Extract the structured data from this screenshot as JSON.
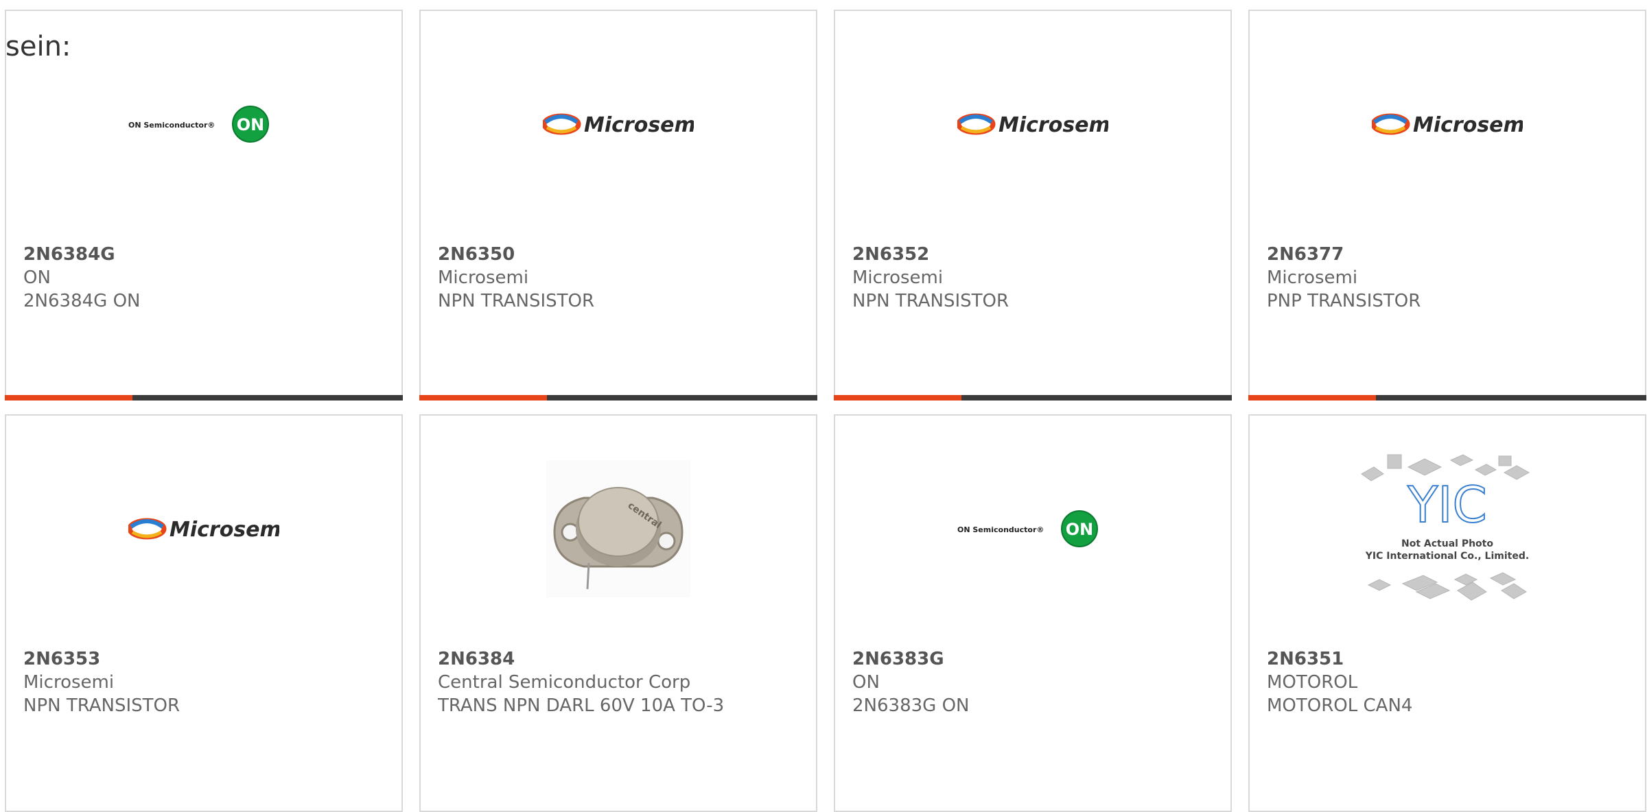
{
  "page": {
    "title": "sein:"
  },
  "colors": {
    "progress_fill": "#e8441a",
    "progress_track": "#3b3b3b",
    "on_green": "#13a040",
    "border": "#d9d9d9"
  },
  "cards": [
    {
      "part_number": "2N6384G",
      "manufacturer": "ON",
      "description": "2N6384G ON",
      "logo": "on-semiconductor-logo",
      "logo_text": "ON Semiconductor®",
      "badge_text": "ON",
      "progress_fraction": 0.32
    },
    {
      "part_number": "2N6350",
      "manufacturer": "Microsemi",
      "description": "NPN TRANSISTOR",
      "logo": "microsemi-logo",
      "logo_text": "Microsemi",
      "progress_fraction": 0.32
    },
    {
      "part_number": "2N6352",
      "manufacturer": "Microsemi",
      "description": "NPN TRANSISTOR",
      "logo": "microsemi-logo",
      "logo_text": "Microsemi",
      "progress_fraction": 0.32
    },
    {
      "part_number": "2N6377",
      "manufacturer": "Microsemi",
      "description": "PNP TRANSISTOR",
      "logo": "microsemi-logo",
      "logo_text": "Microsemi",
      "progress_fraction": 0.32
    },
    {
      "part_number": "2N6353",
      "manufacturer": "Microsemi",
      "description": "NPN TRANSISTOR",
      "logo": "microsemi-logo",
      "logo_text": "Microsemi"
    },
    {
      "part_number": "2N6384",
      "manufacturer": "Central Semiconductor Corp",
      "description": "TRANS NPN DARL 60V 10A TO-3",
      "logo": "to3-transistor-photo",
      "logo_text": "central"
    },
    {
      "part_number": "2N6383G",
      "manufacturer": "ON",
      "description": "2N6383G ON",
      "logo": "on-semiconductor-logo",
      "logo_text": "ON Semiconductor®",
      "badge_text": "ON"
    },
    {
      "part_number": "2N6351",
      "manufacturer": "MOTOROL",
      "description": "MOTOROL CAN4",
      "logo": "yic-placeholder-image",
      "logo_text": "YIC",
      "caption_line1": "Not Actual Photo",
      "caption_line2": "YIC International Co., Limited."
    }
  ]
}
